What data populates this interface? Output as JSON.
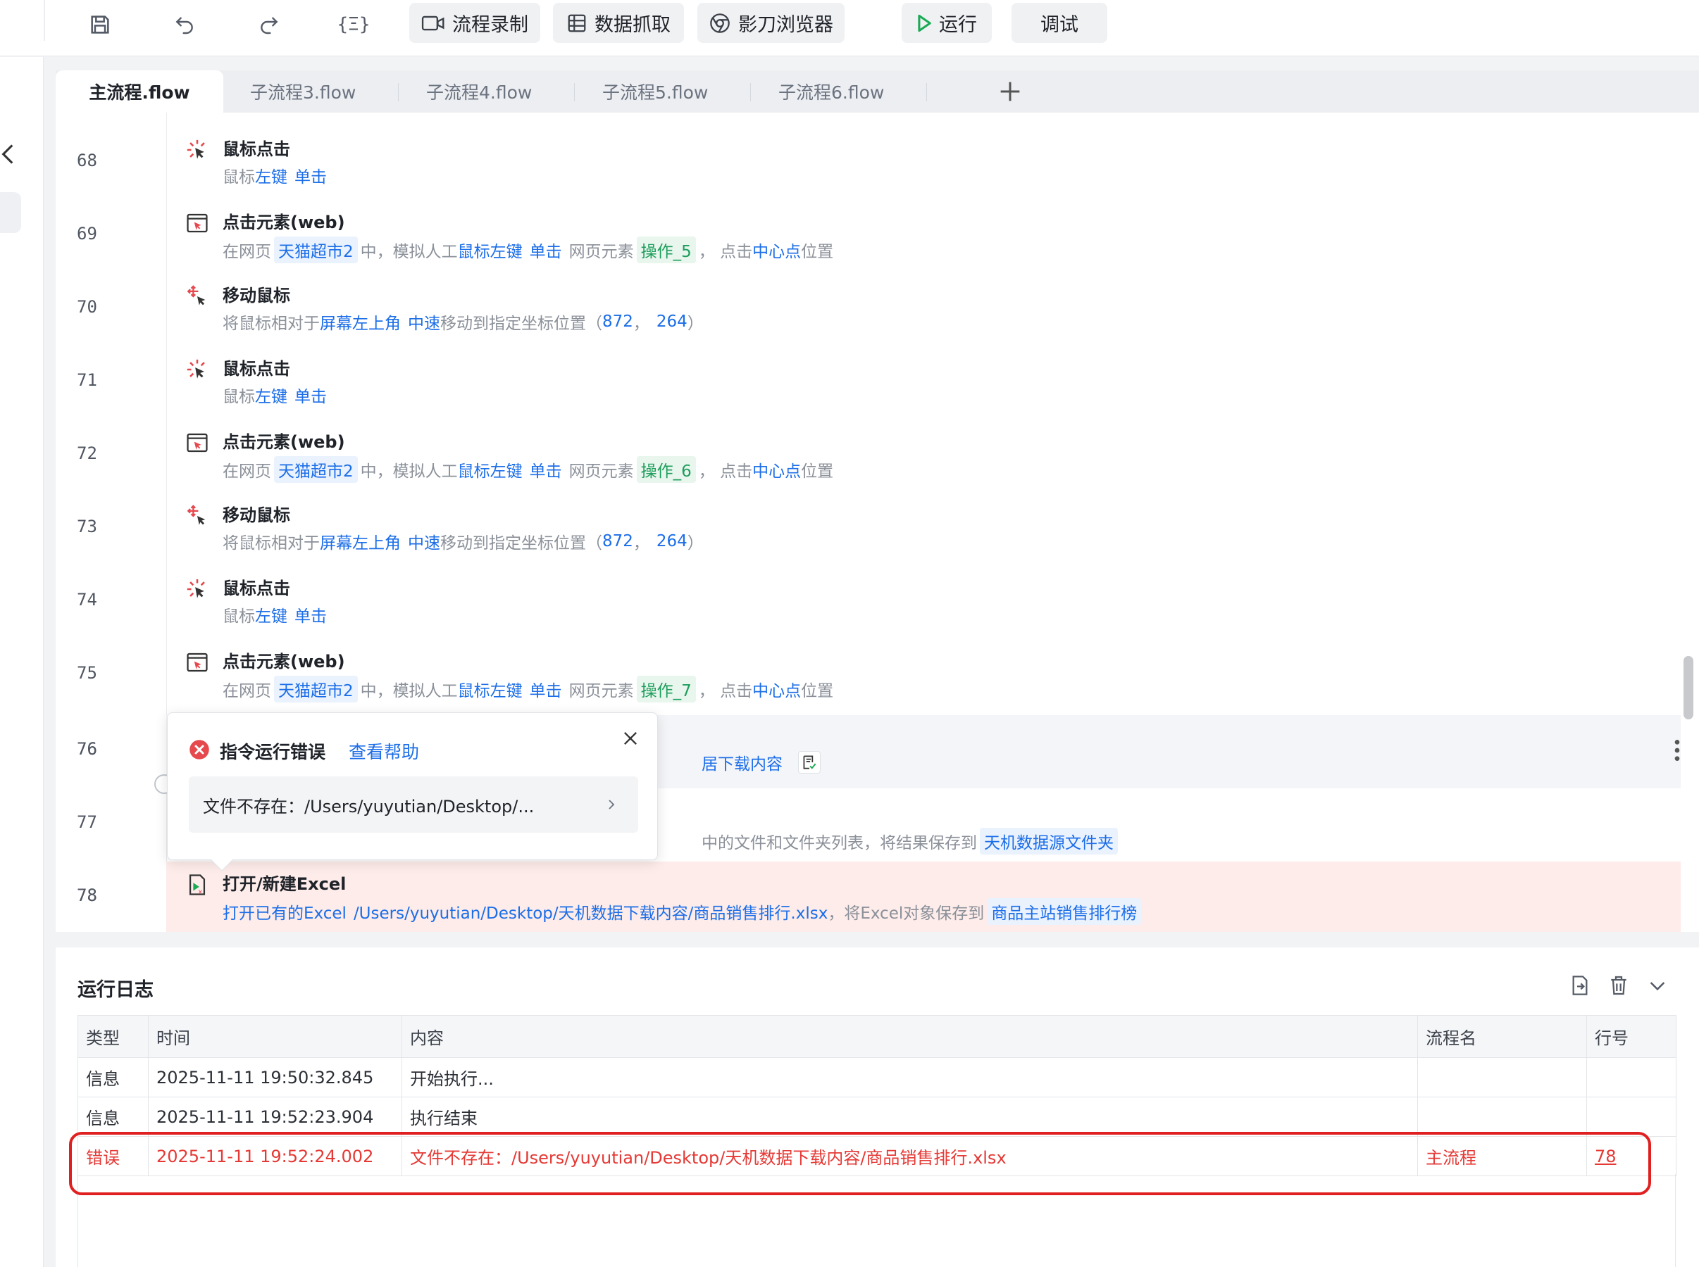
{
  "toolbar": {
    "record_label": "流程录制",
    "scrape_label": "数据抓取",
    "browser_label": "影刀浏览器",
    "run_label": "运行",
    "debug_label": "调试",
    "variables_glyph": "{Ξ}"
  },
  "tabs": [
    "主流程.flow",
    "子流程3.flow",
    "子流程4.flow",
    "子流程5.flow",
    "子流程6.flow"
  ],
  "steps": [
    {
      "line": "68",
      "title": "鼠标点击",
      "desc": {
        "p1": "鼠标",
        "k1": "左键",
        "k2": "单击"
      }
    },
    {
      "line": "69",
      "title": "点击元素(web)",
      "desc": {
        "p1": "在网页",
        "chip1": "天猫超市2",
        "p2": "中，模拟人工",
        "k1": "鼠标左键",
        "k2": "单击",
        "p3": "网页元素",
        "chip2": "操作_5",
        "p4": "，  点击",
        "k3": "中心点",
        "p5": "位置"
      }
    },
    {
      "line": "70",
      "title": "移动鼠标",
      "desc": {
        "p1": "将鼠标相对于",
        "k1": "屏幕左上角",
        "k2": "中速",
        "p2": "移动到指定坐标位置（",
        "k3": "872",
        "p3": "，",
        "k4": "264",
        "p4": "）"
      }
    },
    {
      "line": "71",
      "title": "鼠标点击",
      "desc": {
        "p1": "鼠标",
        "k1": "左键",
        "k2": "单击"
      }
    },
    {
      "line": "72",
      "title": "点击元素(web)",
      "desc": {
        "p1": "在网页",
        "chip1": "天猫超市2",
        "p2": "中，模拟人工",
        "k1": "鼠标左键",
        "k2": "单击",
        "p3": "网页元素",
        "chip2": "操作_6",
        "p4": "，  点击",
        "k3": "中心点",
        "p5": "位置"
      }
    },
    {
      "line": "73",
      "title": "移动鼠标",
      "desc": {
        "p1": "将鼠标相对于",
        "k1": "屏幕左上角",
        "k2": "中速",
        "p2": "移动到指定坐标位置（",
        "k3": "872",
        "p3": "，",
        "k4": "264",
        "p4": "）"
      }
    },
    {
      "line": "74",
      "title": "鼠标点击",
      "desc": {
        "p1": "鼠标",
        "k1": "左键",
        "k2": "单击"
      }
    },
    {
      "line": "75",
      "title": "点击元素(web)",
      "desc": {
        "p1": "在网页",
        "chip1": "天猫超市2",
        "p2": "中，模拟人工",
        "k1": "鼠标左键",
        "k2": "单击",
        "p3": "网页元素",
        "chip2": "操作_7",
        "p4": "，  点击",
        "k3": "中心点",
        "p5": "位置"
      }
    },
    {
      "line": "76",
      "partial": "居下载内容"
    },
    {
      "line": "77",
      "partial_text": "中的文件和文件夹列表，将结果保存到",
      "partial_chip": "天机数据源文件夹"
    },
    {
      "line": "78",
      "title": "打开/新建Excel",
      "desc": {
        "k1": "打开已有的Excel",
        "k2": "/Users/yuyutian/Desktop/天机数据下载内容/商品销售排行.xlsx",
        "p1": "，将Excel对象保存到",
        "chip1": "商品主站销售排行榜"
      }
    }
  ],
  "popover": {
    "title": "指令运行错误",
    "help_link": "查看帮助",
    "message": "文件不存在：/Users/yuyutian/Desktop/..."
  },
  "log": {
    "title": "运行日志",
    "columns": [
      "类型",
      "时间",
      "内容",
      "流程名",
      "行号"
    ],
    "rows": [
      {
        "type": "信息",
        "time": "2025-11-11 19:50:32.845",
        "content": "开始执行...",
        "flow": "",
        "line": ""
      },
      {
        "type": "信息",
        "time": "2025-11-11 19:52:23.904",
        "content": "执行结束",
        "flow": "",
        "line": ""
      },
      {
        "type": "错误",
        "time": "2025-11-11 19:52:24.002",
        "content": "文件不存在：/Users/yuyutian/Desktop/天机数据下载内容/商品销售排行.xlsx",
        "flow": "主流程",
        "line": "78"
      }
    ]
  },
  "colors": {
    "accent": "#1c6ee8",
    "error": "#e53935",
    "success_chip": "#1f9e5c",
    "run_green": "#1aaa55"
  }
}
